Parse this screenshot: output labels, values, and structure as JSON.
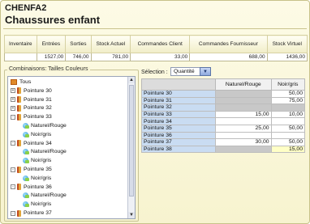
{
  "header": {
    "app_code": "CHENFA2",
    "form_title": "Chaussures enfant"
  },
  "summary": {
    "columns": [
      "Inventaire",
      "Entrées",
      "Sorties",
      "Stock Actuel",
      "Commandes Client",
      "Commandes Fournisseur",
      "Stock Virtuel"
    ],
    "values": [
      "",
      "1527,00",
      "746,00",
      "781,00",
      "33,00",
      "688,00",
      "1436,00"
    ]
  },
  "combinations": {
    "label": "Combinaisons: Tailles Couleurs",
    "tree": [
      {
        "label": "Tous",
        "level": 0,
        "type": "root"
      },
      {
        "label": "Pointure 30",
        "level": 1,
        "type": "size",
        "expander": "+"
      },
      {
        "label": "Pointure 31",
        "level": 1,
        "type": "size",
        "expander": "+"
      },
      {
        "label": "Pointure 32",
        "level": 1,
        "type": "size",
        "expander": "+"
      },
      {
        "label": "Pointure 33",
        "level": 1,
        "type": "size",
        "expander": "-"
      },
      {
        "label": "Naturel/Rouge",
        "level": 2,
        "type": "color"
      },
      {
        "label": "Noir/gris",
        "level": 2,
        "type": "color"
      },
      {
        "label": "Pointure 34",
        "level": 1,
        "type": "size",
        "expander": "-"
      },
      {
        "label": "Naturel/Rouge",
        "level": 2,
        "type": "color"
      },
      {
        "label": "Noir/gris",
        "level": 2,
        "type": "color"
      },
      {
        "label": "Pointure 35",
        "level": 1,
        "type": "size",
        "expander": "-"
      },
      {
        "label": "Noir/gris",
        "level": 2,
        "type": "color"
      },
      {
        "label": "Pointure 36",
        "level": 1,
        "type": "size",
        "expander": "-"
      },
      {
        "label": "Naturel/Rouge",
        "level": 2,
        "type": "color"
      },
      {
        "label": "Noir/gris",
        "level": 2,
        "type": "color"
      },
      {
        "label": "Pointure 37",
        "level": 1,
        "type": "size",
        "expander": "-"
      }
    ]
  },
  "selection": {
    "label": "Sélection :",
    "value": "Quantité"
  },
  "matrix": {
    "columns": [
      "Naturel/Rouge",
      "Noir/gris"
    ],
    "rows": [
      {
        "label": "Pointure 30",
        "cells": [
          "",
          "50,00"
        ],
        "kinds": [
          "dis",
          "val"
        ]
      },
      {
        "label": "Pointure 31",
        "cells": [
          "",
          "75,00"
        ],
        "kinds": [
          "dis",
          "val"
        ]
      },
      {
        "label": "Pointure 32",
        "cells": [
          "",
          ""
        ],
        "kinds": [
          "dis",
          "dis"
        ]
      },
      {
        "label": "Pointure 33",
        "cells": [
          "15,00",
          "10,00"
        ],
        "kinds": [
          "val",
          "val"
        ]
      },
      {
        "label": "Pointure 34",
        "cells": [
          "",
          ""
        ],
        "kinds": [
          "val",
          "val"
        ]
      },
      {
        "label": "Pointure 35",
        "cells": [
          "25,00",
          "50,00"
        ],
        "kinds": [
          "val",
          "val"
        ]
      },
      {
        "label": "Pointure 36",
        "cells": [
          "",
          ""
        ],
        "kinds": [
          "val",
          "val"
        ]
      },
      {
        "label": "Pointure 37",
        "cells": [
          "30,00",
          "50,00"
        ],
        "kinds": [
          "val",
          "val"
        ]
      },
      {
        "label": "Pointure 38",
        "cells": [
          "",
          "15,00"
        ],
        "kinds": [
          "dis",
          "hl"
        ]
      }
    ]
  }
}
